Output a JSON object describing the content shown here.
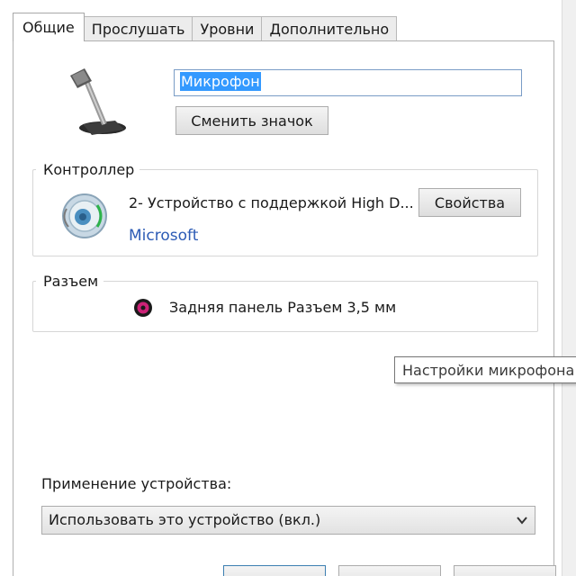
{
  "tabs": [
    {
      "label": "Общие"
    },
    {
      "label": "Прослушать"
    },
    {
      "label": "Уровни"
    },
    {
      "label": "Дополнительно"
    }
  ],
  "device": {
    "name_value": "Микрофон",
    "change_icon_label": "Сменить значок"
  },
  "controller": {
    "group_title": "Контроллер",
    "device_name": "2- Устройство с поддержкой High D...",
    "vendor": "Microsoft",
    "properties_label": "Свойства"
  },
  "jack": {
    "group_title": "Разъем",
    "description": "Задняя панель Разъем 3,5 мм",
    "color": "#cc2277"
  },
  "tooltip": {
    "text": "Настройки микрофона"
  },
  "usage": {
    "label": "Применение устройства:",
    "selected": "Использовать это устройство (вкл.)"
  },
  "colors": {
    "selection": "#3399ff",
    "vendor_link": "#2c5bb5"
  }
}
